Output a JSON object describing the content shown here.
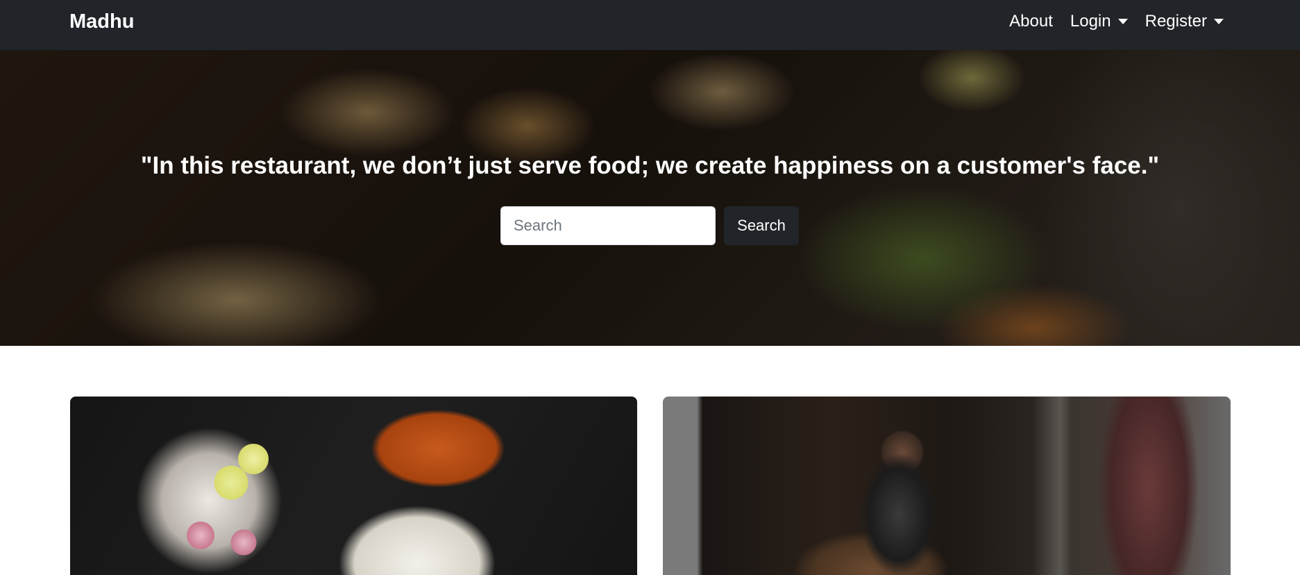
{
  "navbar": {
    "brand": "Madhu",
    "links": [
      {
        "label": "About",
        "has_dropdown": false
      },
      {
        "label": "Login",
        "has_dropdown": true
      },
      {
        "label": "Register",
        "has_dropdown": true
      }
    ],
    "background": "#212529"
  },
  "hero": {
    "quote": "\"In this restaurant, we don’t just serve food; we create happiness on a customer's face.\"",
    "search": {
      "placeholder": "Search",
      "value": "",
      "button_label": "Search"
    }
  },
  "cards": [
    {
      "image": "indian-thali-food-photo"
    },
    {
      "image": "restaurant-window-person-photo"
    }
  ]
}
